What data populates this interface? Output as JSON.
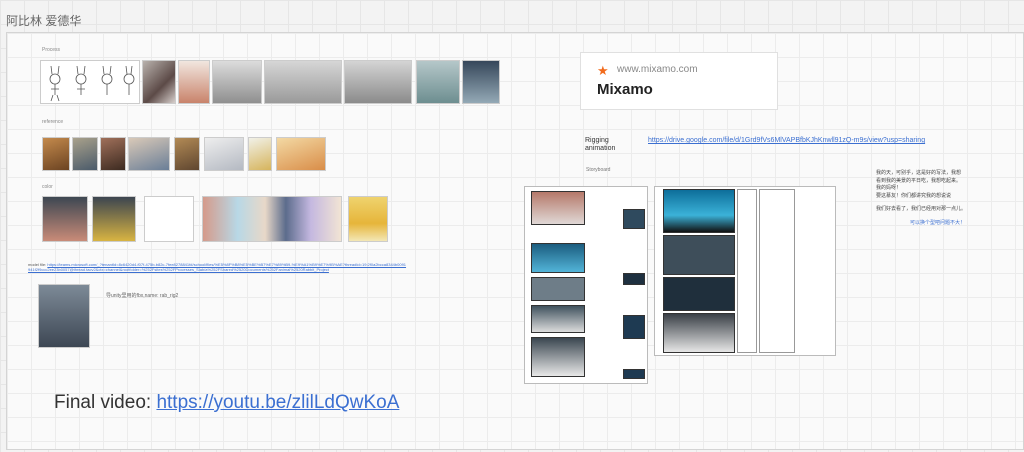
{
  "board": {
    "title": "阿比林 爱德华"
  },
  "process": {
    "label": "Process"
  },
  "reference": {
    "label": "reference"
  },
  "color": {
    "label": "color"
  },
  "model_file": {
    "label": "model file:",
    "url": "https://teams.microsoft.com/_?tenantId=8c6420d4-f07f-475b-b82c-7fee8278841f#/school/files/%E5%8F%B8%E5%BE%B7%E7%89%B9-%E9%A1%B9%E7%9B%AE?threadId=19:2f0a2bcca8344b0091941f2f9ccc2ee23b0057@thread.tacv2&ctx=channel&rootfolder=%252Fsites%252FProcesses_Slab/a%252FShared%2520Documents%252Fanimal%2520Rabbit_Project"
  },
  "unity_note": "导unity里用的fbx,name: rab_rig2",
  "mixamo": {
    "url": "www.mixamo.com",
    "name": "Mixamo"
  },
  "rigging": {
    "label": "Rigging animation",
    "link": "https://drive.google.com/file/d/1Grd9fVs6MlVAPBfbKJhKnwll91zQ-m9s/view?usp=sharing"
  },
  "storyboard": {
    "label": "Storyboard"
  },
  "notes": [
    "我的天，可别乎，这是好的写法，我想",
    "看到我的美景的平日吃，我想吃起来。",
    "我的妈呀！",
    "要这慕友！你们都讲究我的想说说",
    "我们好去看了，我们已经用对那一点儿。"
  ],
  "note_blue": "可以换个型吧问题不大！",
  "final": {
    "label": "Final video: ",
    "link": "https://youtu.be/zlilLdQwKoA"
  },
  "colors": {
    "link": "#3b6fd1",
    "mixamo_orange": "#f26b1d"
  }
}
